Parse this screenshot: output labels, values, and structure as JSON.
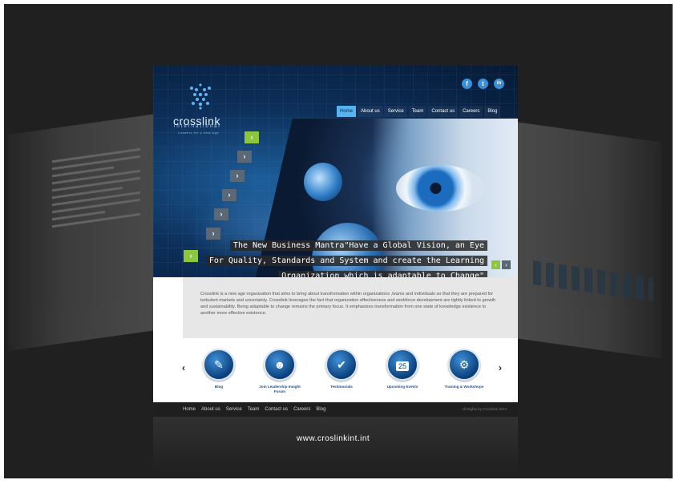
{
  "site": {
    "brand": "crosslink",
    "brand_sub": "international",
    "tagline": "Leaders for a New Age"
  },
  "social": [
    "f",
    "t",
    "in"
  ],
  "nav": [
    "Home",
    "About us",
    "Service",
    "Team",
    "Contact us",
    "Careers",
    "Blog"
  ],
  "hero": {
    "caption_lines": [
      "The New Business Mantra\"Have a Global Vision, an Eye",
      "For Quality, Standards and System  and create the Learning",
      "Organization which is adaptable to Change\""
    ]
  },
  "about": {
    "text": "Crosslink is a new age organization that aims to bring about transformation within organizations ,teams and individuals so that they are prepared for turbulent markets and uncertainty. Crosslink leverages the fact that organization effectiveness and workforce development are tightly linked to growth and sustainability. Being adaptable to change remains the primary focus. It emphasizes transformation from one state of knowledge existence to another more effective existence."
  },
  "services": [
    {
      "label": "Blog",
      "icon": "blog-icon"
    },
    {
      "label": "Join Leadership Insight Forum",
      "icon": "group-icon"
    },
    {
      "label": "Testimonials",
      "icon": "testimonial-icon"
    },
    {
      "label": "Upcoming Events",
      "icon": "calendar-icon",
      "day": "25"
    },
    {
      "label": "Training & Workshops",
      "icon": "gear-group-icon"
    }
  ],
  "footer": {
    "links": [
      "Home",
      "About us",
      "Service",
      "Team",
      "Contact us",
      "Careers",
      "Blog"
    ],
    "copyright": "All Rights by Crosslink 2014"
  },
  "url": "www.croslinkint.int",
  "colors": {
    "accent": "#55b3f0",
    "green": "#8cc63f",
    "navy": "#0d2f5a"
  }
}
